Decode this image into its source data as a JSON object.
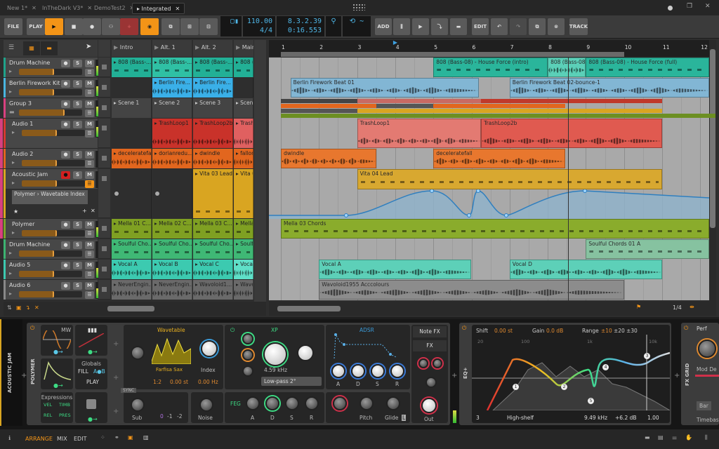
{
  "tabs": [
    {
      "label": "New 1*"
    },
    {
      "label": "InTheDark V3*"
    },
    {
      "label": "DemoTest2"
    },
    {
      "label": "Integrated",
      "active": true
    }
  ],
  "toolbar": {
    "file": "FILE",
    "play": "PLAY",
    "add": "ADD",
    "edit": "EDIT",
    "track": "TRACK",
    "tempo": "110.00",
    "signature": "4/4",
    "position_beats": "8.3.2.39",
    "position_time": "0:16.553"
  },
  "colors": {
    "accent": "#f39417",
    "transport_play": "#f39417",
    "record_arm": "#9a3434",
    "display_text": "#4fb7e8",
    "automation": "#2f7fbf"
  },
  "launcher": {
    "scenes": [
      "Intro",
      "Alt. 1",
      "Alt. 2",
      "Main"
    ]
  },
  "arranger": {
    "bars": [
      "1",
      "2",
      "3",
      "4",
      "5",
      "6",
      "7",
      "8",
      "9",
      "10",
      "11",
      "12"
    ],
    "loop": [
      1,
      10
    ],
    "play_start_bar": 4,
    "playhead_bar": 8.53,
    "zoom": "1/4"
  },
  "tracks": [
    {
      "name": "Drum Machine",
      "color": "#1fa38a",
      "h": 29,
      "arm": false,
      "clips": [
        [
          "808 (Bass-...",
          "#22b096"
        ],
        [
          "808 (Bass-...",
          "#2fc0a4"
        ],
        [
          "808 (Bass-...",
          "#22b096"
        ],
        [
          "808 (...",
          "#22b096"
        ]
      ],
      "arr": [
        {
          "name": "808 (Bass-08) - House Force (intro)",
          "s": 5,
          "e": 8,
          "c": "#2ab59b"
        },
        {
          "name": "808 (Bass-08)",
          "s": 8,
          "e": 9,
          "c": "#5bd0b8"
        },
        {
          "name": "808 (Bass-08) - House Force (full)",
          "s": 9,
          "e": 12.4,
          "c": "#2ab59b"
        }
      ]
    },
    {
      "name": "Berlin Firework Kit",
      "color": "#49b5e0",
      "h": 29,
      "clips": [
        null,
        [
          "Berlin Fire...",
          "#3ab0e8"
        ],
        [
          "Berlin Fire...",
          "#3ab0e8"
        ],
        null
      ],
      "arr": [
        {
          "name": "Berlin Firework Beat 01",
          "s": 1.25,
          "e": 6.2,
          "c": "#82b6d4"
        },
        {
          "name": "Berlin Firework Beat 02-bounce-1",
          "s": 7,
          "e": 12.4,
          "c": "#82b6d4"
        }
      ]
    },
    {
      "name": "Group 3",
      "color": "#d8407f",
      "h": 29,
      "group": true,
      "clips": [
        [
          "Scene 1",
          "#444"
        ],
        [
          "Scene 2",
          "#444"
        ],
        [
          "Scene 3",
          "#444"
        ],
        [
          "Scen...",
          "#444"
        ]
      ],
      "arr": []
    },
    {
      "name": "Audio 1",
      "color": "#d6392f",
      "h": 43,
      "indent": true,
      "clips": [
        null,
        [
          "TrashLoop1",
          "#c9322a"
        ],
        [
          "TrashLoop2b",
          "#c9322a"
        ],
        [
          "Trash...",
          "#e06060"
        ]
      ],
      "arr": [
        {
          "name": "TrashLoop1",
          "s": 3,
          "e": 6.25,
          "c": "#e37a72"
        },
        {
          "name": "TrashLoop2b",
          "s": 6.25,
          "e": 11,
          "c": "#e05a50"
        }
      ]
    },
    {
      "name": "Audio 2",
      "color": "#e2641e",
      "h": 29,
      "indent": true,
      "clips": [
        [
          "deceleratefall",
          "#e2661e"
        ],
        [
          "dorianredu...",
          "#e2661e"
        ],
        [
          "dwindle",
          "#e2661e"
        ],
        [
          "fallon...",
          "#e2661e"
        ]
      ],
      "arr": [
        {
          "name": "dwindle",
          "s": 1,
          "e": 3.5,
          "c": "#e8772e"
        },
        {
          "name": "deceleratefall",
          "s": 5,
          "e": 8.45,
          "c": "#e8772e"
        }
      ]
    },
    {
      "name": "Acoustic Jam",
      "color": "#d9a521",
      "h": 71,
      "indent": true,
      "arm": true,
      "automation": "Polymer › Wavetable Index",
      "clips": [
        null,
        null,
        [
          "Vita 03 Lead",
          "#d9a521"
        ],
        [
          "Vita 0...",
          "#d9a521"
        ]
      ],
      "arr": [
        {
          "name": "Vita 04 Lead",
          "s": 3,
          "e": 11,
          "c": "#d8a830",
          "lane": true
        }
      ]
    },
    {
      "name": "Polymer",
      "color": "#7fa22a",
      "h": 29,
      "indent": true,
      "clips": [
        [
          "Mella 01 C...",
          "#7fa022"
        ],
        [
          "Mella 02 C...",
          "#7fa022"
        ],
        [
          "Mella 03 C...",
          "#7fa022"
        ],
        [
          "Mella...",
          "#7fa022"
        ]
      ],
      "arr": [
        {
          "name": "Mella 03 Chords",
          "s": 1,
          "e": 12.4,
          "c": "#8aac2c"
        }
      ]
    },
    {
      "name": "Drum Machine",
      "color": "#3cb371",
      "h": 29,
      "clips": [
        [
          "Soulful Cho...",
          "#3fb875"
        ],
        [
          "Soulful Cho...",
          "#3fb875"
        ],
        [
          "Soulful Cho...",
          "#3fb875"
        ],
        [
          "Soulf...",
          "#3fb875"
        ]
      ],
      "arr": [
        {
          "name": "Soulful Chords 01 A",
          "s": 9,
          "e": 12.4,
          "c": "#86c2a0"
        }
      ]
    },
    {
      "name": "Audio 5",
      "color": "#3cc9b0",
      "h": 29,
      "clips": [
        [
          "Vocal A",
          "#3ccab0"
        ],
        [
          "Vocal B",
          "#3ccab0"
        ],
        [
          "Vocal C",
          "#3ccab0"
        ],
        [
          "Vocal...",
          "#5fe0c8"
        ]
      ],
      "arr": [
        {
          "name": "Vocal A",
          "s": 2,
          "e": 6,
          "c": "#5dd0b8"
        },
        {
          "name": "Vocal D",
          "s": 7,
          "e": 11,
          "c": "#5dd0b8"
        }
      ]
    },
    {
      "name": "Audio 6",
      "color": "#888888",
      "h": 29,
      "clips": [
        [
          "NeverEngin...",
          "#6a6a6a"
        ],
        [
          "NeverEngin...",
          "#6a6a6a"
        ],
        [
          "Wavoloid1...",
          "#6a6a6a"
        ],
        [
          "Wave...",
          "#6a6a6a"
        ]
      ],
      "arr": [
        {
          "name": "Wavoloid1955 Acccolours",
          "s": 2,
          "e": 10,
          "c": "#8c8c8c"
        }
      ]
    }
  ],
  "device": {
    "track_label": "ACOUSTIC JAM",
    "polymer_label": "POLYMER",
    "mw": "MW",
    "globals": "Globals",
    "fill": "FILL",
    "ab": "A●B",
    "play": "PLAY",
    "expressions": "Expressions",
    "vel": "VEL",
    "timb": "TIMB",
    "rel": "REL",
    "pres": "PRES",
    "wavetable": {
      "title": "Wavetable",
      "preset": "Farfisa Sax",
      "index": "Index",
      "ratio": "1:2",
      "semitones": "0.00 st",
      "hz": "0.00 Hz",
      "sync": "SYNC",
      "sub": "Sub",
      "noise": "Noise",
      "oct0": "0",
      "oct1": "-1",
      "oct2": "-2"
    },
    "filter": {
      "title": "XP",
      "freq": "4.59 kHz",
      "type": "Low-pass 2°",
      "feg": "FEG",
      "a": "A",
      "d": "D",
      "s": "S",
      "r": "R"
    },
    "adsr": {
      "title": "ADSR",
      "a": "A",
      "d": "D",
      "s": "S",
      "r": "R",
      "pitch": "Pitch",
      "glide": "Glide",
      "l": "L"
    },
    "notefx": "Note FX",
    "fx": "FX",
    "out": "Out",
    "eq": {
      "label": "EQ+",
      "shift": "Shift",
      "shift_val": "0.00 st",
      "gain": "Gain",
      "gain_val": "0.0 dB",
      "range": "Range",
      "r10": "±10",
      "r20": "±20",
      "r30": "±30",
      "f20": "20",
      "f100": "100",
      "f1k": "1k",
      "f10k": "10k",
      "band": "3",
      "band_type": "High-shelf",
      "freq": "9.49 kHz",
      "band_gain": "+6.2 dB",
      "q": "1.00"
    },
    "fxgrid": {
      "label": "FX GRID",
      "perf": "Perf",
      "mod": "Mod De",
      "bar": "Bar",
      "timebase": "Timebas"
    }
  },
  "bottom": {
    "arrange": "ARRANGE",
    "mix": "MIX",
    "edit": "EDIT"
  }
}
